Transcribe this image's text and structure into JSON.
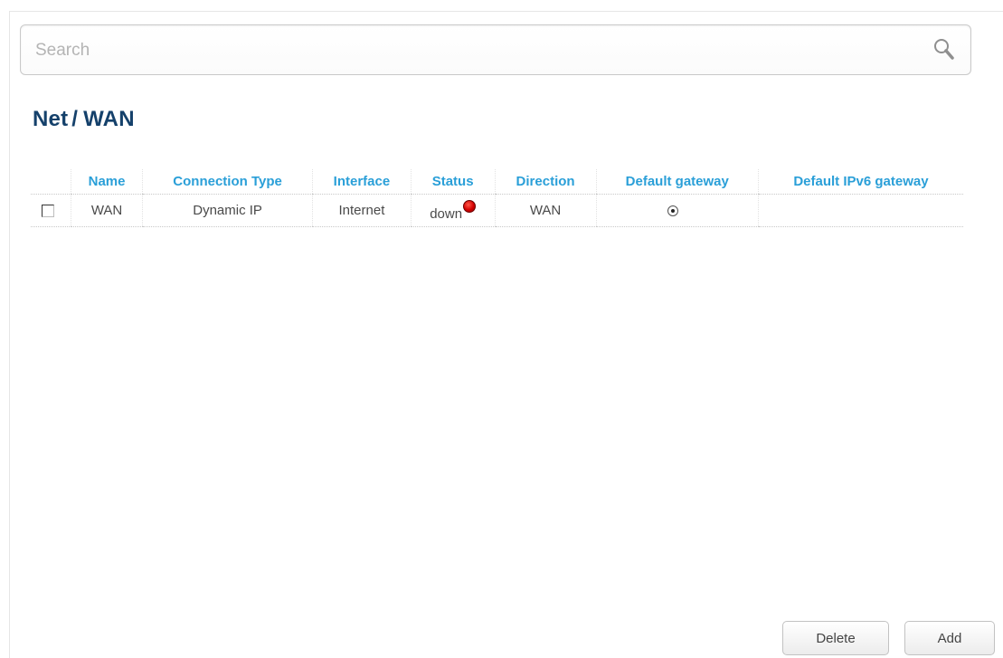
{
  "search": {
    "placeholder": "Search",
    "value": ""
  },
  "breadcrumb": {
    "section": "Net",
    "separator": "/",
    "page": "WAN"
  },
  "table": {
    "columns": [
      "Name",
      "Connection Type",
      "Interface",
      "Status",
      "Direction",
      "Default gateway",
      "Default IPv6 gateway"
    ],
    "rows": [
      {
        "selected": false,
        "name": "WAN",
        "connection_type": "Dynamic IP",
        "interface": "Internet",
        "status": "down",
        "status_color": "#d40000",
        "direction": "WAN",
        "default_gateway": true,
        "default_ipv6_gateway": ""
      }
    ]
  },
  "buttons": {
    "delete": "Delete",
    "add": "Add"
  },
  "colors": {
    "title": "#15416b",
    "header": "#2a9fd8",
    "status_down": "#d40000"
  }
}
